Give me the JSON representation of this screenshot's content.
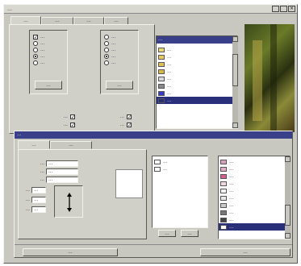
{
  "window": {
    "title": "…"
  },
  "top_tabs": [
    "…",
    "…",
    "…",
    "…"
  ],
  "top_panel": {
    "group_a": {
      "options": [
        {
          "label": "…",
          "kind": "check",
          "checked": true
        },
        {
          "label": "…",
          "kind": "radio",
          "checked": false
        },
        {
          "label": "…",
          "kind": "radio",
          "checked": false
        },
        {
          "label": "…",
          "kind": "radio",
          "checked": true
        },
        {
          "label": "…",
          "kind": "radio",
          "checked": false
        }
      ],
      "button": "…"
    },
    "group_b": {
      "options": [
        {
          "label": "…",
          "kind": "radio",
          "checked": false
        },
        {
          "label": "…",
          "kind": "radio",
          "checked": false
        },
        {
          "label": "…",
          "kind": "radio",
          "checked": false
        },
        {
          "label": "…",
          "kind": "radio",
          "checked": true
        },
        {
          "label": "…",
          "kind": "radio",
          "checked": false
        }
      ],
      "button": "…"
    },
    "checkboxes": [
      {
        "label": "…",
        "checked": true
      },
      {
        "label": "…",
        "checked": true
      },
      {
        "label": "…",
        "checked": true
      },
      {
        "label": "…",
        "checked": true
      }
    ]
  },
  "top_list": {
    "header": "…",
    "items": [
      {
        "label": "…",
        "color": "#e8d870"
      },
      {
        "label": "…",
        "color": "#e8c860"
      },
      {
        "label": "…",
        "color": "#e0c050"
      },
      {
        "label": "…",
        "color": "#d8b848"
      },
      {
        "label": "…",
        "color": "#d8d8d8"
      },
      {
        "label": "…",
        "color": "#888888"
      },
      {
        "label": "…",
        "color": "#3a3ac8"
      },
      {
        "label": "…",
        "color": "#2a2f7a"
      }
    ],
    "selected_index": 7
  },
  "sub_dialog": {
    "title": "…",
    "tabs": [
      "…",
      "…"
    ],
    "fields": [
      {
        "label": "…",
        "value": "…"
      },
      {
        "label": "…",
        "value": "…"
      },
      {
        "label": "…",
        "value": "…"
      }
    ],
    "spin_fields": [
      {
        "label": "…",
        "value": "…"
      },
      {
        "label": "…",
        "value": "…"
      },
      {
        "label": "…",
        "value": "…"
      }
    ],
    "middle_list": {
      "items": [
        {
          "label": "…",
          "color": "#ffffff"
        },
        {
          "label": "…",
          "color": "#ffffff"
        }
      ],
      "buttons": [
        "…",
        "…"
      ]
    },
    "right_list": {
      "items": [
        {
          "label": "…",
          "color": "#d8a0c0"
        },
        {
          "label": "…",
          "color": "#e0b0c8"
        },
        {
          "label": "…",
          "color": "#d06090"
        },
        {
          "label": "…",
          "color": "#f0d8e0"
        },
        {
          "label": "…",
          "color": "#f4f4f4"
        },
        {
          "label": "…",
          "color": "#e8e8e8"
        },
        {
          "label": "…",
          "color": "#cccccc"
        },
        {
          "label": "…",
          "color": "#777777"
        },
        {
          "label": "…",
          "color": "#444444"
        },
        {
          "label": "…",
          "color": "#ffffff"
        }
      ],
      "selected_index": 9
    },
    "footer_buttons": [
      "…",
      "…"
    ]
  }
}
